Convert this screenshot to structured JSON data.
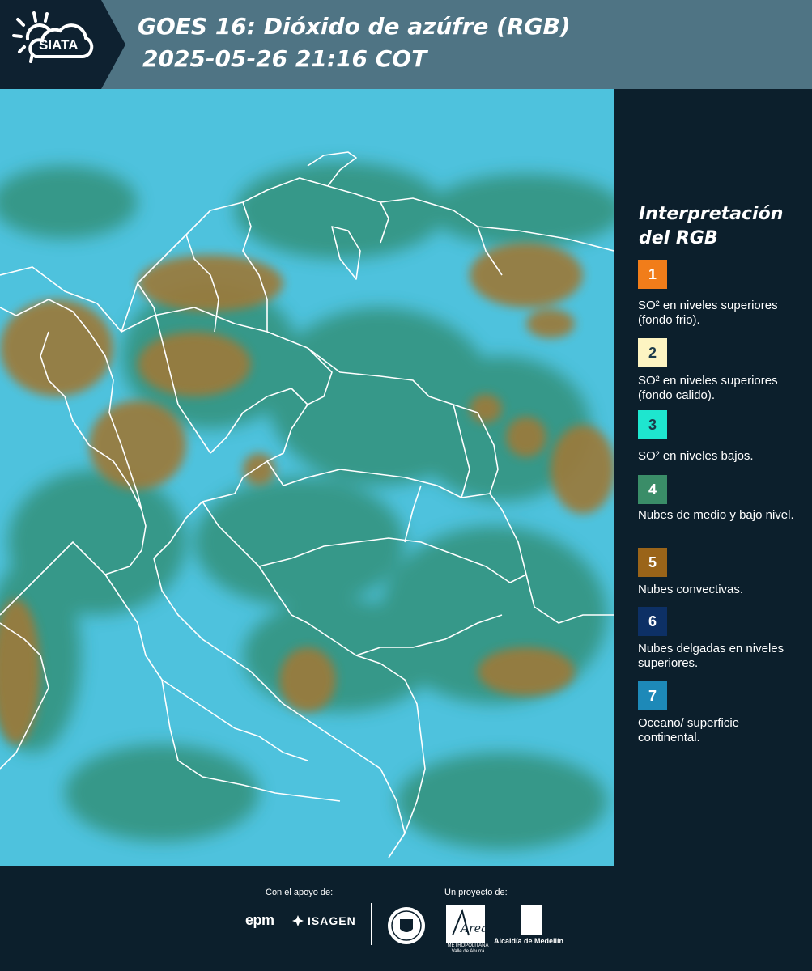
{
  "header": {
    "logo_text": "SIATA",
    "title_line1": "GOES 16: Dióxido de azúfre (RGB)",
    "title_line2": "2025-05-26 21:16 COT"
  },
  "map": {
    "description_icon": "satellite-map-image"
  },
  "legend": {
    "title_line1": "Interpretación",
    "title_line2": "del RGB",
    "items": [
      {
        "number": "1",
        "color": "#f17d1a",
        "label": "SO² en niveles superiores (fondo frio)."
      },
      {
        "number": "2",
        "color": "#fdf4c2",
        "label": "SO² en niveles superiores (fondo calido)."
      },
      {
        "number": "3",
        "color": "#1ee6cf",
        "label": "SO² en niveles bajos."
      },
      {
        "number": "4",
        "color": "#3a8d68",
        "label": "Nubes de medio y bajo nivel."
      },
      {
        "number": "5",
        "color": "#9a6419",
        "label": "Nubes convectivas."
      },
      {
        "number": "6",
        "color": "#0d3065",
        "label": "Nubes delgadas en niveles superiores."
      },
      {
        "number": "7",
        "color": "#1d89b8",
        "label": "Oceano/ superficie continental."
      }
    ]
  },
  "footer": {
    "support_label": "Con el apoyo de:",
    "project_label": "Un proyecto de:",
    "epm": "epm",
    "isagen": "ISAGEN",
    "area_logo_text": "Área",
    "area_sub": "METROPOLITANA Valle de Aburrá",
    "alcaldia": "Alcaldía de Medellín"
  }
}
